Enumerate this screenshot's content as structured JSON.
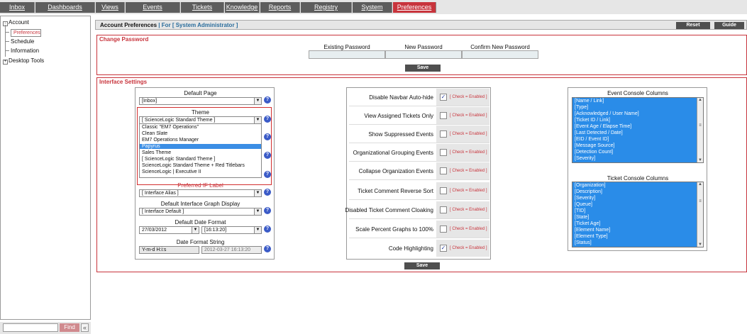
{
  "nav": {
    "tabs": [
      "Inbox",
      "Dashboards",
      "Views",
      "Events",
      "Tickets",
      "Knowledge",
      "Reports",
      "Registry",
      "System",
      "Preferences"
    ],
    "active": "Preferences",
    "active_color": "#c8343c"
  },
  "sidebar": {
    "items": [
      {
        "label": "Account",
        "icon": "minus-box-icon"
      },
      {
        "label": "Preferences"
      },
      {
        "label": "Schedule"
      },
      {
        "label": "Information"
      },
      {
        "label": "Desktop Tools",
        "icon": "plus-box-icon"
      }
    ],
    "find_label": "Find",
    "collapse_label": "«"
  },
  "header": {
    "title": "Account Preferences",
    "subtitle": "| For [ System Administrator ]",
    "reset_label": "Reset",
    "guide_label": "Guide"
  },
  "password": {
    "section_title": "Change Password",
    "existing_label": "Existing Password",
    "new_label": "New Password",
    "confirm_label": "Confirm New Password",
    "save_label": "Save"
  },
  "interface": {
    "section_title": "Interface Settings",
    "default_page_label": "Default Page",
    "default_page_value": "[Inbox]",
    "theme_label": "Theme",
    "theme_value": "[ ScienceLogic Standard Theme ]",
    "theme_options": [
      "Classic \"EM7 Operations\"",
      "Clean Slate",
      "EM7 Operations Manager",
      "Papyrus",
      "Sales Theme",
      "[ ScienceLogic Standard Theme ]",
      "ScienceLogic Standard Theme + Red Titlebars",
      "ScienceLogic | Executive II"
    ],
    "theme_highlighted": "Papyrus",
    "preferred_if_label": "Preferred IF Label",
    "preferred_if_value": "[ Interface Alias ]",
    "graph_display_label": "Default Interface Graph Display",
    "graph_display_value": "[ Interface Default ]",
    "date_format_label": "Default Date Format",
    "date_value": "27/03/2012",
    "time_value": "[16:13:20]",
    "date_string_label": "Date Format String",
    "date_string_value": "Y-m-d H:i:s",
    "date_string_preview": "2012-03-27 16:13:20",
    "checkboxes": [
      {
        "label": "Disable Navbar Auto-hide",
        "checked": true,
        "status": "[ Check = Enabled ]"
      },
      {
        "label": "View Assigned Tickets Only",
        "checked": false,
        "status": "[ Check = Enabled ]"
      },
      {
        "label": "Show Suppressed Events",
        "checked": false,
        "status": "[ Check = Enabled ]"
      },
      {
        "label": "Organizational Grouping Events",
        "checked": false,
        "status": "[ Check = Enabled ]"
      },
      {
        "label": "Collapse Organization Events",
        "checked": false,
        "status": "[ Check = Enabled ]"
      },
      {
        "label": "Ticket Comment Reverse Sort",
        "checked": false,
        "status": "[ Check = Enabled ]"
      },
      {
        "label": "Disabled Ticket Comment Cloaking",
        "checked": false,
        "status": "[ Check = Enabled ]"
      },
      {
        "label": "Scale Percent Graphs to 100%",
        "checked": false,
        "status": "[ Check = Enabled ]"
      },
      {
        "label": "Code Highlighting",
        "checked": true,
        "status": "[ Check = Enabled ]"
      }
    ],
    "event_columns_title": "Event Console Columns",
    "event_columns": [
      "[Name / Link]",
      "[Type]",
      "[Acknowledged / User Name]",
      "[Ticket ID / Link]",
      "[Event Age / Elapse Time]",
      "[Last Detected / Date]",
      "[EID / Event ID]",
      "[Message Source]",
      "[Detection Count]",
      "[Severity]"
    ],
    "ticket_columns_title": "Ticket Console Columns",
    "ticket_columns": [
      "[Organization]",
      "[Description]",
      "[Severity]",
      "[Queue]",
      "[TID]",
      "[State]",
      "[Ticket Age]",
      "[Element Name]",
      "[Element Type]",
      "[Status]"
    ],
    "save_label": "Save"
  }
}
